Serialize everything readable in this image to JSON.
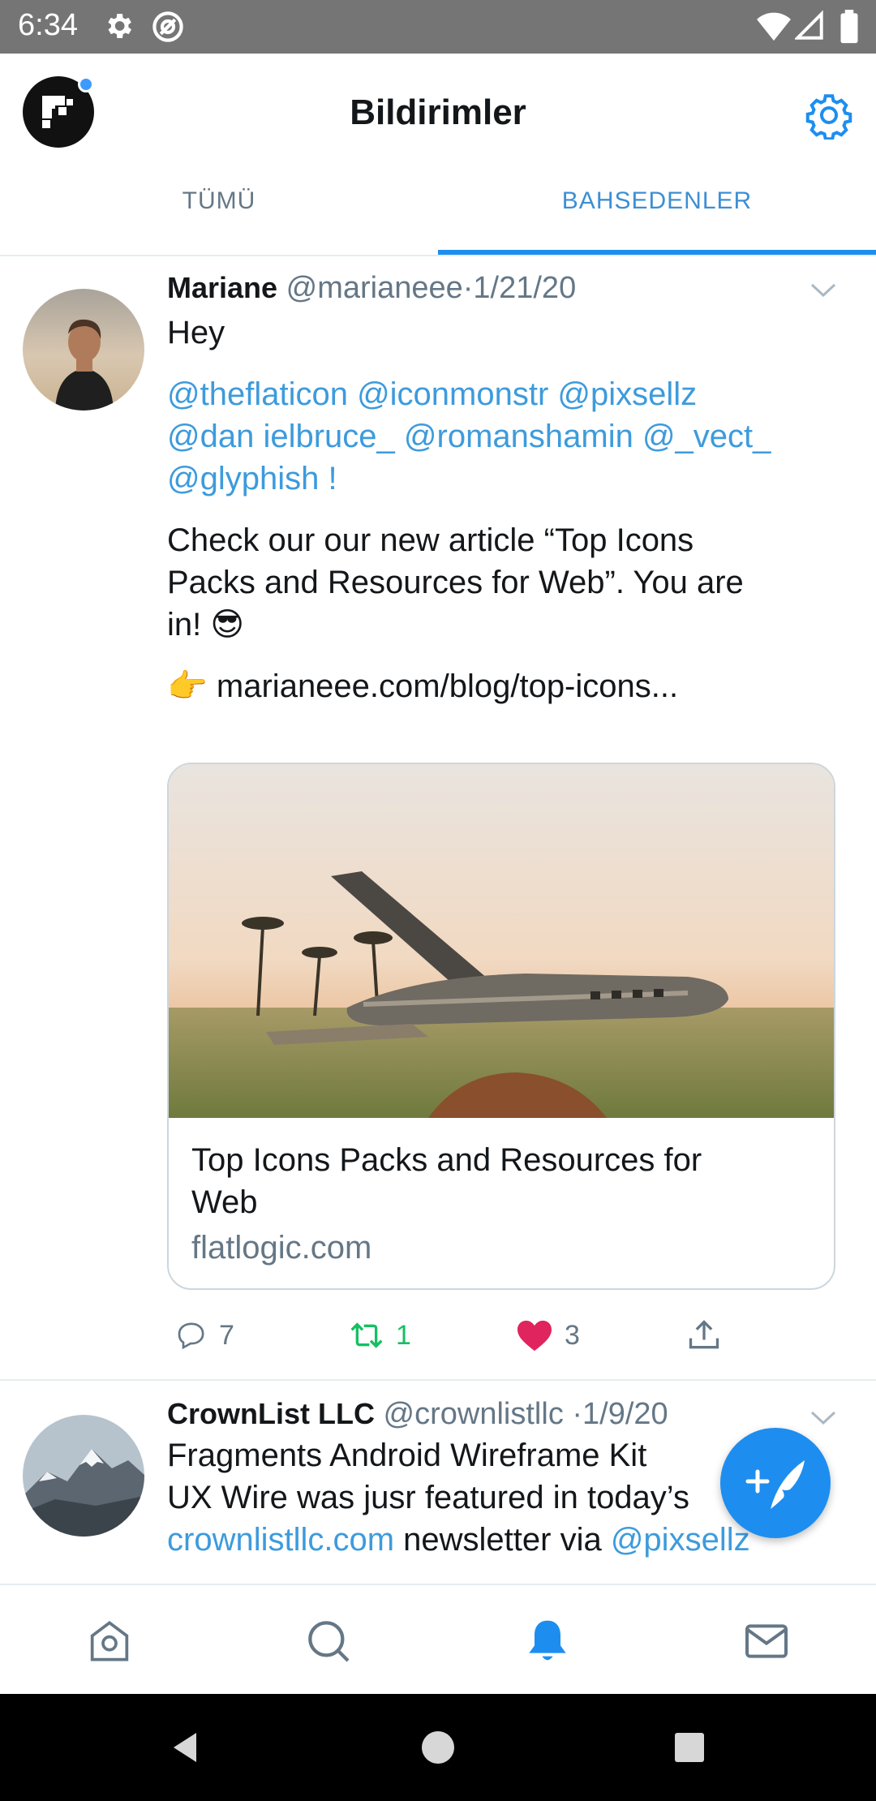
{
  "status_bar": {
    "time": "6:34"
  },
  "header": {
    "title": "Bildirimler"
  },
  "tabs": [
    {
      "label": "TÜMÜ",
      "selected": false
    },
    {
      "label": "BAHSEDENLER",
      "selected": true
    }
  ],
  "tweets": [
    {
      "name": "Mariane",
      "handle": "@marianeee",
      "date": "·1/21/20",
      "line1": "Hey",
      "mentions_line1": "@theflaticon @iconmonstr @pixsellz",
      "mentions_line2": "@dan ielbruce_ @romanshamin @_vect_",
      "mentions_line3": "@glyphish !",
      "body_line1": "Check our our new article “Top Icons",
      "body_line2": "Packs and Resources for Web”. You are",
      "body_line3": "in! 😎",
      "link_line": "👉 marianeee.com/blog/top-icons...",
      "card": {
        "title_line1": "Top Icons Packs and Resources for",
        "title_line2": "Web",
        "domain": "flatlogic.com"
      },
      "actions": {
        "replies": "7",
        "retweets": "1",
        "likes": "3"
      }
    },
    {
      "name": "CrownList LLC",
      "handle": "@crownlistllc",
      "date": "·1/9/20",
      "line1": "Fragments Android Wireframe Kit",
      "line2": "UX Wire was jusr featured in today’s",
      "line3_link": "crownlistllc.com",
      "line3_text": " newsletter via ",
      "line3_mention": "@pixsellz"
    }
  ],
  "colors": {
    "accent": "#1d8ef0",
    "link": "#3d9bdc",
    "retweet": "#17bf63",
    "like": "#e0245e"
  }
}
